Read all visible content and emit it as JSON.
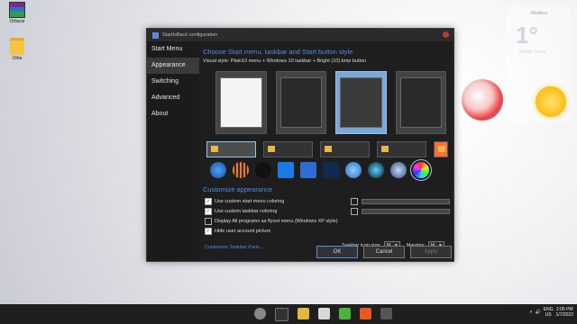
{
  "desktop": {
    "icons": [
      {
        "label": "Orbsrar"
      },
      {
        "label": "Orbs"
      }
    ],
    "widget": {
      "title": "Weather",
      "temp": "1°",
      "condition": "Mostly Sunny"
    }
  },
  "window": {
    "title": "StartIsBack configuration",
    "sidebar": [
      "Start Menu",
      "Appearance",
      "Switching",
      "Advanced",
      "About"
    ],
    "selected_index": 1,
    "heading": "Choose Start menu, taskbar and Start button style",
    "visual_style": "Visual style:  Plain10 menu + Windows 10 taskbar + Bright (10).bmp button",
    "customize_heading": "Customize appearance",
    "options": [
      {
        "label": "Use custom start menu coloring",
        "checked": true
      },
      {
        "label": "Use custom taskbar coloring",
        "checked": true
      },
      {
        "label": "Display All programs as flyout menu (Windows XP style)",
        "checked": false
      },
      {
        "label": "Hide user account picture",
        "checked": true
      }
    ],
    "customize_link": "Customize Taskbar Parts...",
    "icon_size_label": "Taskbar icon size:",
    "icon_size_value": "M",
    "margins_label": "Margins:",
    "margins_value": "M",
    "buttons": {
      "ok": "OK",
      "cancel": "Cancel",
      "apply": "Apply"
    }
  },
  "taskbar": {
    "lang": "ENG",
    "region": "US",
    "time": "2:05 PM",
    "date": "1/7/2022"
  },
  "colors": {
    "accent": "#4f8fe3",
    "window_bg": "#1e1e1e",
    "taskbar_bg": "#1f1f1f"
  }
}
